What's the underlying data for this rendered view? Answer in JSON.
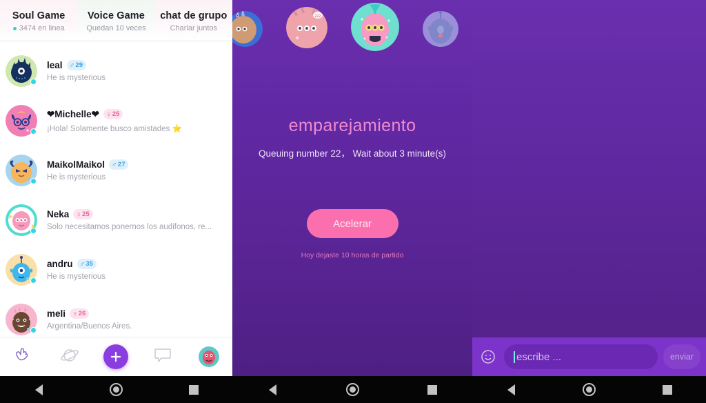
{
  "left_panel": {
    "tabs": [
      {
        "title": "Soul Game",
        "subtitle": "3474 en linea",
        "has_online_dot": true
      },
      {
        "title": "Voice Game",
        "subtitle": "Quedan 10 veces",
        "has_online_dot": false
      },
      {
        "title": "chat de grupo",
        "subtitle": "Charlar juntos",
        "has_online_dot": false
      }
    ],
    "users": [
      {
        "name": "leal",
        "gender": "male",
        "gender_symbol": "♂",
        "age": "29",
        "subtitle": "He is mysterious"
      },
      {
        "name": "❤Michelle❤",
        "gender": "female",
        "gender_symbol": "♀",
        "age": "25",
        "subtitle": "¡Hola! Solamente busco amistades ⭐"
      },
      {
        "name": "MaikolMaikol",
        "gender": "male",
        "gender_symbol": "♂",
        "age": "27",
        "subtitle": "He is mysterious"
      },
      {
        "name": "Neka",
        "gender": "female",
        "gender_symbol": "♀",
        "age": "25",
        "subtitle": "Solo necesitamos ponernos los audifonos, re..."
      },
      {
        "name": "andru",
        "gender": "male",
        "gender_symbol": "♂",
        "age": "35",
        "subtitle": "He is mysterious"
      },
      {
        "name": "meli",
        "gender": "female",
        "gender_symbol": "♀",
        "age": "26",
        "subtitle": "Argentina/Buenos Aires."
      }
    ],
    "bottom_nav": [
      {
        "icon": "hand-star-icon",
        "label": ""
      },
      {
        "icon": "planet-icon",
        "label": ""
      },
      {
        "icon": "plus-icon",
        "label": ""
      },
      {
        "icon": "chat-bubble-icon",
        "label": ""
      },
      {
        "icon": "profile-avatar",
        "label": ""
      }
    ]
  },
  "mid_panel": {
    "title": "emparejamiento",
    "queue_text": "Queuing number 22， Wait about 3 minute(s)",
    "accelerate_label": "Acelerar",
    "note": "Hoy dejaste 10 horas de partido",
    "avatar_count": 4
  },
  "right_panel": {
    "emoji_icon": "smiley-icon",
    "input_placeholder": "escribe ...",
    "input_value": "",
    "send_label": "enviar"
  },
  "system_nav": {
    "back": "back-triangle-icon",
    "home": "home-circle-icon",
    "recents": "recents-square-icon"
  },
  "colors": {
    "accent_purple": "#8b3ee0",
    "accent_pink": "#fb6fae",
    "title_pink": "#f08ad0",
    "online_teal": "#2fd6c6",
    "badge_male_bg": "#dff0fb",
    "badge_female_bg": "#fde3ee"
  }
}
